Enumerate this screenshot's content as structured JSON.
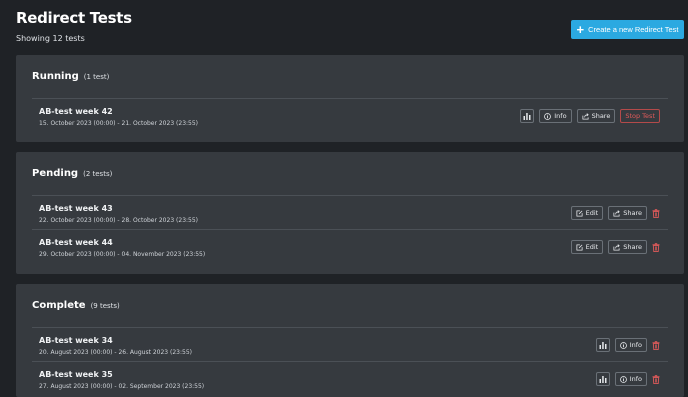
{
  "header": {
    "title": "Redirect Tests",
    "subtitle": "Showing 12 tests",
    "create_label": "Create a new Redirect Test"
  },
  "actions": {
    "info": "Info",
    "share": "Share",
    "stop": "Stop Test",
    "edit": "Edit"
  },
  "running": {
    "title": "Running",
    "count": "(1 test)",
    "tests": [
      {
        "name": "AB-test week 42",
        "dates": "15. October 2023 (00:00) - 21. October 2023 (23:55)"
      }
    ]
  },
  "pending": {
    "title": "Pending",
    "count": "(2 tests)",
    "tests": [
      {
        "name": "AB-test week 43",
        "dates": "22. October 2023 (00:00) - 28. October 2023 (23:55)"
      },
      {
        "name": "AB-test week 44",
        "dates": "29. October 2023 (00:00) - 04. November 2023 (23:55)"
      }
    ]
  },
  "complete": {
    "title": "Complete",
    "count": "(9 tests)",
    "tests": [
      {
        "name": "AB-test week 34",
        "dates": "20. August 2023 (00:00) - 26. August 2023 (23:55)"
      },
      {
        "name": "AB-test week 35",
        "dates": "27. August 2023 (00:00) - 02. September 2023 (23:55)"
      }
    ]
  },
  "colors": {
    "accent": "#2ba9e1",
    "danger": "#e05a5a",
    "panel": "#363a3f",
    "background": "#1f2226"
  }
}
